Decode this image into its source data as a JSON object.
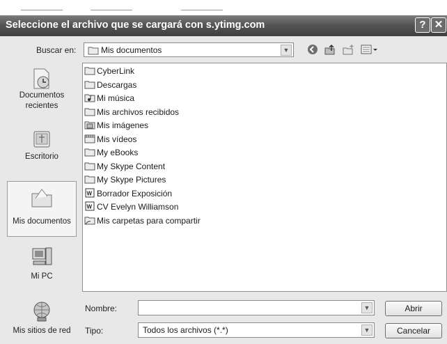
{
  "dialog": {
    "title": "Seleccione el archivo que se cargará con s.ytimg.com",
    "help_button": "?",
    "close_button": "✕"
  },
  "toolbar": {
    "look_in_label": "Buscar en:",
    "look_in_value": "Mis documentos",
    "icons": [
      "back-icon",
      "up-folder-icon",
      "new-folder-icon",
      "view-menu-icon"
    ]
  },
  "places": [
    {
      "label": "Documentos recientes",
      "icon": "recent-documents-icon"
    },
    {
      "label": "Escritorio",
      "icon": "desktop-icon"
    },
    {
      "label": "Mis documentos",
      "icon": "my-documents-icon",
      "selected": true
    },
    {
      "label": "Mi PC",
      "icon": "my-computer-icon"
    },
    {
      "label": "Mis sitios de red",
      "icon": "network-places-icon"
    }
  ],
  "files": [
    {
      "name": "CyberLink",
      "icon": "folder-icon"
    },
    {
      "name": "Descargas",
      "icon": "folder-icon"
    },
    {
      "name": "Mi música",
      "icon": "music-folder-icon"
    },
    {
      "name": "Mis archivos recibidos",
      "icon": "folder-icon"
    },
    {
      "name": "Mis imágenes",
      "icon": "pictures-folder-icon"
    },
    {
      "name": "Mis vídeos",
      "icon": "videos-folder-icon"
    },
    {
      "name": "My eBooks",
      "icon": "folder-icon"
    },
    {
      "name": "My Skype Content",
      "icon": "folder-icon"
    },
    {
      "name": "My Skype Pictures",
      "icon": "folder-icon"
    },
    {
      "name": "Borrador Exposición",
      "icon": "word-document-icon"
    },
    {
      "name": "CV Evelyn Williamson",
      "icon": "word-document-icon"
    },
    {
      "name": "Mis carpetas para compartir",
      "icon": "shared-folder-icon"
    }
  ],
  "footer": {
    "name_label": "Nombre:",
    "name_value": "",
    "type_label": "Tipo:",
    "type_value": "Todos los archivos (*.*)",
    "open_button": "Abrir",
    "cancel_button": "Cancelar"
  }
}
